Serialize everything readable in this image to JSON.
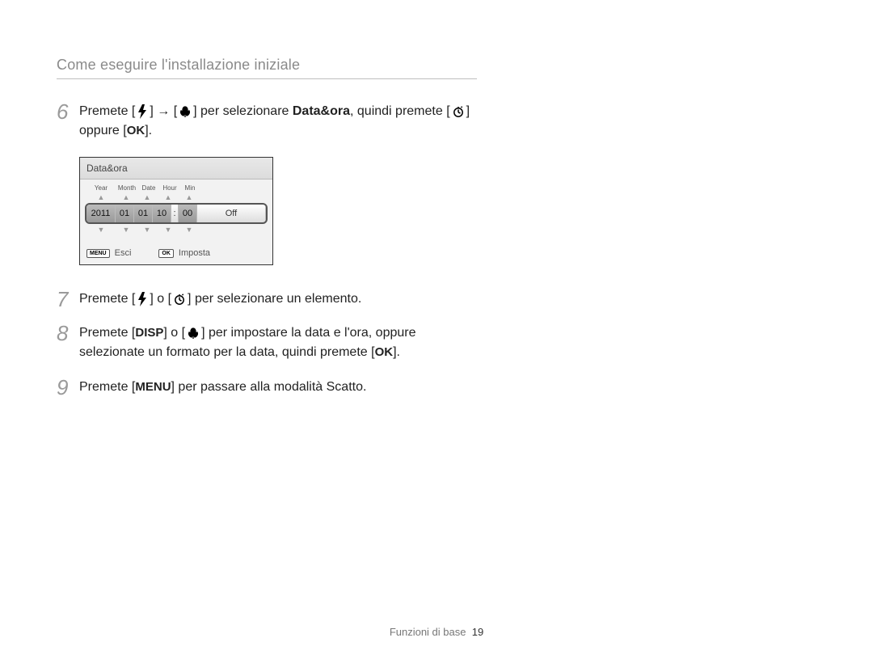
{
  "headerTitle": "Come eseguire l'installazione iniziale",
  "steps": {
    "s6": {
      "num": "6",
      "t1a": "Premete [",
      "t1b": "] → [",
      "t1c": "] per selezionare ",
      "t1bold": "Data&ora",
      "t1d": ", quindi premete [",
      "t1e": "] oppure [",
      "t1f": "]."
    },
    "s7": {
      "num": "7",
      "t1a": "Premete [",
      "t1b": "] o [",
      "t1c": "] per selezionare un elemento."
    },
    "s8": {
      "num": "8",
      "t1a": "Premete [",
      "t1b": "] o [",
      "t1c": "] per impostare la data e l'ora, oppure selezionate un formato per la data, quindi premete [",
      "t1d": "]."
    },
    "s9": {
      "num": "9",
      "t1a": "Premete [",
      "t1b": "] per passare alla modalità Scatto."
    }
  },
  "glyphs": {
    "ok": "OK",
    "disp": "DISP",
    "menu": "MENU"
  },
  "screen": {
    "title": "Data&ora",
    "labels": {
      "year": "Year",
      "month": "Month",
      "date": "Date",
      "hour": "Hour",
      "min": "Min"
    },
    "values": {
      "year": "2011",
      "month": "01",
      "date": "01",
      "hour": "10",
      "min": "00",
      "mode": "Off"
    },
    "footer": {
      "menuGlyph": "MENU",
      "esci": "Esci",
      "okGlyph": "OK",
      "imposta": "Imposta"
    }
  },
  "footer": {
    "label": "Funzioni di base",
    "page": "19"
  }
}
